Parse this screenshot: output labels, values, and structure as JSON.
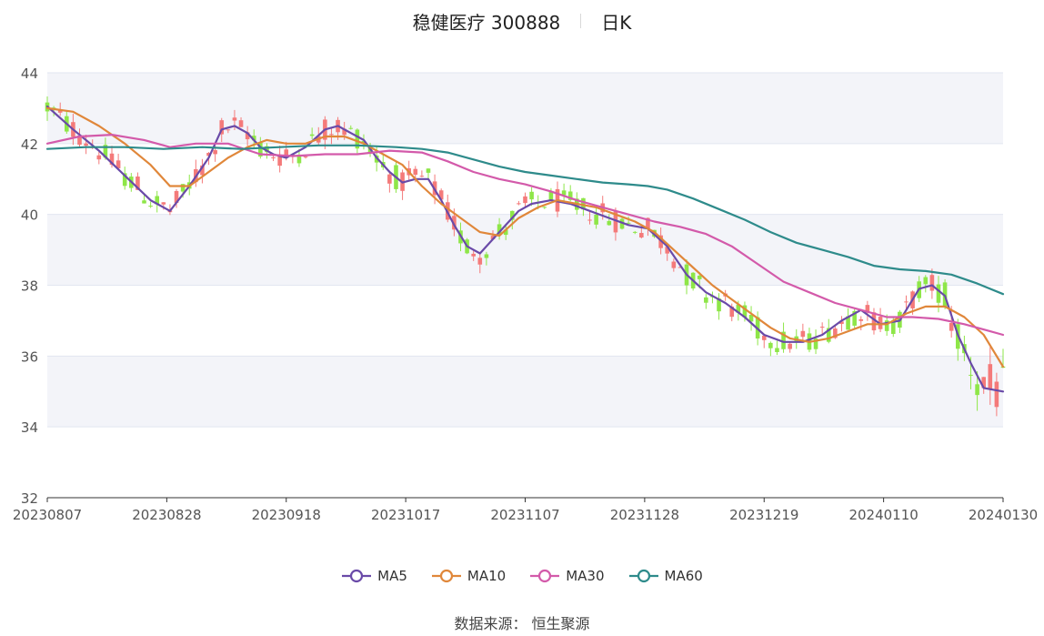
{
  "title": {
    "name": "稳健医疗 300888",
    "period": "日K"
  },
  "source": "数据来源： 恒生聚源",
  "chart_data": {
    "type": "candlestick",
    "y_axis": {
      "min": 32,
      "max": 44,
      "ticks": [
        32,
        34,
        36,
        38,
        40,
        42,
        44
      ]
    },
    "x_axis": {
      "labels": [
        "20230807",
        "20230828",
        "20230918",
        "20231017",
        "20231107",
        "20231128",
        "20231219",
        "20240110",
        "20240130"
      ]
    },
    "colors": {
      "up": "#f47a7a",
      "down": "#8ee648",
      "band": "#f3f4f9",
      "grid": "#e2e6f0",
      "axis": "#333333"
    },
    "series": [
      {
        "name": "MA5",
        "color": "#6a4aa8",
        "values": [
          [
            0,
            43.05
          ],
          [
            4,
            42.4
          ],
          [
            8,
            41.8
          ],
          [
            12,
            41.1
          ],
          [
            16,
            40.4
          ],
          [
            19,
            40.1
          ],
          [
            22,
            40.8
          ],
          [
            25,
            41.6
          ],
          [
            27,
            42.4
          ],
          [
            29,
            42.5
          ],
          [
            31,
            42.3
          ],
          [
            33,
            41.9
          ],
          [
            35,
            41.7
          ],
          [
            37,
            41.6
          ],
          [
            40,
            41.9
          ],
          [
            43,
            42.4
          ],
          [
            45,
            42.5
          ],
          [
            47,
            42.3
          ],
          [
            49,
            42.1
          ],
          [
            51,
            41.6
          ],
          [
            53,
            41.2
          ],
          [
            55,
            40.9
          ],
          [
            57,
            41.0
          ],
          [
            59,
            41.0
          ],
          [
            61,
            40.4
          ],
          [
            63,
            39.7
          ],
          [
            65,
            39.1
          ],
          [
            67,
            38.9
          ],
          [
            69,
            39.3
          ],
          [
            71,
            39.7
          ],
          [
            73,
            40.1
          ],
          [
            75,
            40.3
          ],
          [
            78,
            40.4
          ],
          [
            81,
            40.3
          ],
          [
            84,
            40.1
          ],
          [
            87,
            39.9
          ],
          [
            90,
            39.7
          ],
          [
            93,
            39.6
          ],
          [
            96,
            39.1
          ],
          [
            99,
            38.3
          ],
          [
            102,
            37.8
          ],
          [
            105,
            37.5
          ],
          [
            108,
            37.1
          ],
          [
            111,
            36.6
          ],
          [
            114,
            36.4
          ],
          [
            117,
            36.4
          ],
          [
            120,
            36.6
          ],
          [
            123,
            37.0
          ],
          [
            126,
            37.3
          ],
          [
            129,
            36.9
          ],
          [
            132,
            37.0
          ],
          [
            135,
            37.9
          ],
          [
            137,
            38.0
          ],
          [
            139,
            37.7
          ],
          [
            141,
            36.6
          ],
          [
            143,
            35.8
          ],
          [
            145,
            35.1
          ],
          [
            148,
            35.0
          ]
        ]
      },
      {
        "name": "MA10",
        "color": "#e0873a",
        "values": [
          [
            0,
            43.0
          ],
          [
            4,
            42.9
          ],
          [
            8,
            42.5
          ],
          [
            12,
            42.0
          ],
          [
            16,
            41.4
          ],
          [
            19,
            40.8
          ],
          [
            22,
            40.8
          ],
          [
            25,
            41.2
          ],
          [
            28,
            41.6
          ],
          [
            31,
            41.9
          ],
          [
            34,
            42.1
          ],
          [
            37,
            42.0
          ],
          [
            40,
            42.0
          ],
          [
            43,
            42.2
          ],
          [
            46,
            42.2
          ],
          [
            49,
            42.0
          ],
          [
            52,
            41.7
          ],
          [
            55,
            41.4
          ],
          [
            58,
            40.8
          ],
          [
            61,
            40.3
          ],
          [
            64,
            39.9
          ],
          [
            67,
            39.5
          ],
          [
            70,
            39.4
          ],
          [
            73,
            39.9
          ],
          [
            76,
            40.2
          ],
          [
            79,
            40.4
          ],
          [
            82,
            40.3
          ],
          [
            85,
            40.2
          ],
          [
            88,
            40.0
          ],
          [
            91,
            39.8
          ],
          [
            94,
            39.5
          ],
          [
            97,
            39.0
          ],
          [
            100,
            38.5
          ],
          [
            103,
            38.0
          ],
          [
            106,
            37.6
          ],
          [
            109,
            37.2
          ],
          [
            112,
            36.8
          ],
          [
            115,
            36.5
          ],
          [
            118,
            36.4
          ],
          [
            121,
            36.5
          ],
          [
            124,
            36.7
          ],
          [
            127,
            36.9
          ],
          [
            130,
            36.9
          ],
          [
            133,
            37.2
          ],
          [
            136,
            37.4
          ],
          [
            139,
            37.4
          ],
          [
            142,
            37.1
          ],
          [
            145,
            36.6
          ],
          [
            148,
            35.7
          ]
        ]
      },
      {
        "name": "MA30",
        "color": "#d35aaa",
        "values": [
          [
            0,
            42.0
          ],
          [
            5,
            42.2
          ],
          [
            10,
            42.25
          ],
          [
            15,
            42.1
          ],
          [
            19,
            41.9
          ],
          [
            23,
            42.0
          ],
          [
            28,
            42.0
          ],
          [
            33,
            41.7
          ],
          [
            38,
            41.65
          ],
          [
            43,
            41.7
          ],
          [
            48,
            41.7
          ],
          [
            53,
            41.8
          ],
          [
            58,
            41.75
          ],
          [
            62,
            41.5
          ],
          [
            66,
            41.2
          ],
          [
            70,
            41.0
          ],
          [
            74,
            40.85
          ],
          [
            78,
            40.65
          ],
          [
            82,
            40.4
          ],
          [
            86,
            40.2
          ],
          [
            90,
            40.0
          ],
          [
            94,
            39.8
          ],
          [
            98,
            39.65
          ],
          [
            102,
            39.45
          ],
          [
            106,
            39.1
          ],
          [
            110,
            38.6
          ],
          [
            114,
            38.1
          ],
          [
            118,
            37.8
          ],
          [
            122,
            37.5
          ],
          [
            126,
            37.3
          ],
          [
            130,
            37.1
          ],
          [
            134,
            37.1
          ],
          [
            138,
            37.05
          ],
          [
            142,
            36.9
          ],
          [
            146,
            36.7
          ],
          [
            148,
            36.6
          ]
        ]
      },
      {
        "name": "MA60",
        "color": "#2e8b8b",
        "values": [
          [
            0,
            41.85
          ],
          [
            6,
            41.9
          ],
          [
            12,
            41.9
          ],
          [
            18,
            41.85
          ],
          [
            24,
            41.9
          ],
          [
            30,
            41.85
          ],
          [
            36,
            41.9
          ],
          [
            42,
            41.95
          ],
          [
            48,
            41.95
          ],
          [
            54,
            41.9
          ],
          [
            58,
            41.85
          ],
          [
            62,
            41.75
          ],
          [
            66,
            41.55
          ],
          [
            70,
            41.35
          ],
          [
            74,
            41.2
          ],
          [
            78,
            41.1
          ],
          [
            82,
            41.0
          ],
          [
            86,
            40.9
          ],
          [
            90,
            40.85
          ],
          [
            93,
            40.8
          ],
          [
            96,
            40.7
          ],
          [
            100,
            40.45
          ],
          [
            104,
            40.15
          ],
          [
            108,
            39.85
          ],
          [
            112,
            39.5
          ],
          [
            116,
            39.2
          ],
          [
            120,
            39.0
          ],
          [
            124,
            38.8
          ],
          [
            128,
            38.55
          ],
          [
            132,
            38.45
          ],
          [
            136,
            38.4
          ],
          [
            140,
            38.3
          ],
          [
            144,
            38.05
          ],
          [
            148,
            37.75
          ]
        ]
      }
    ]
  }
}
